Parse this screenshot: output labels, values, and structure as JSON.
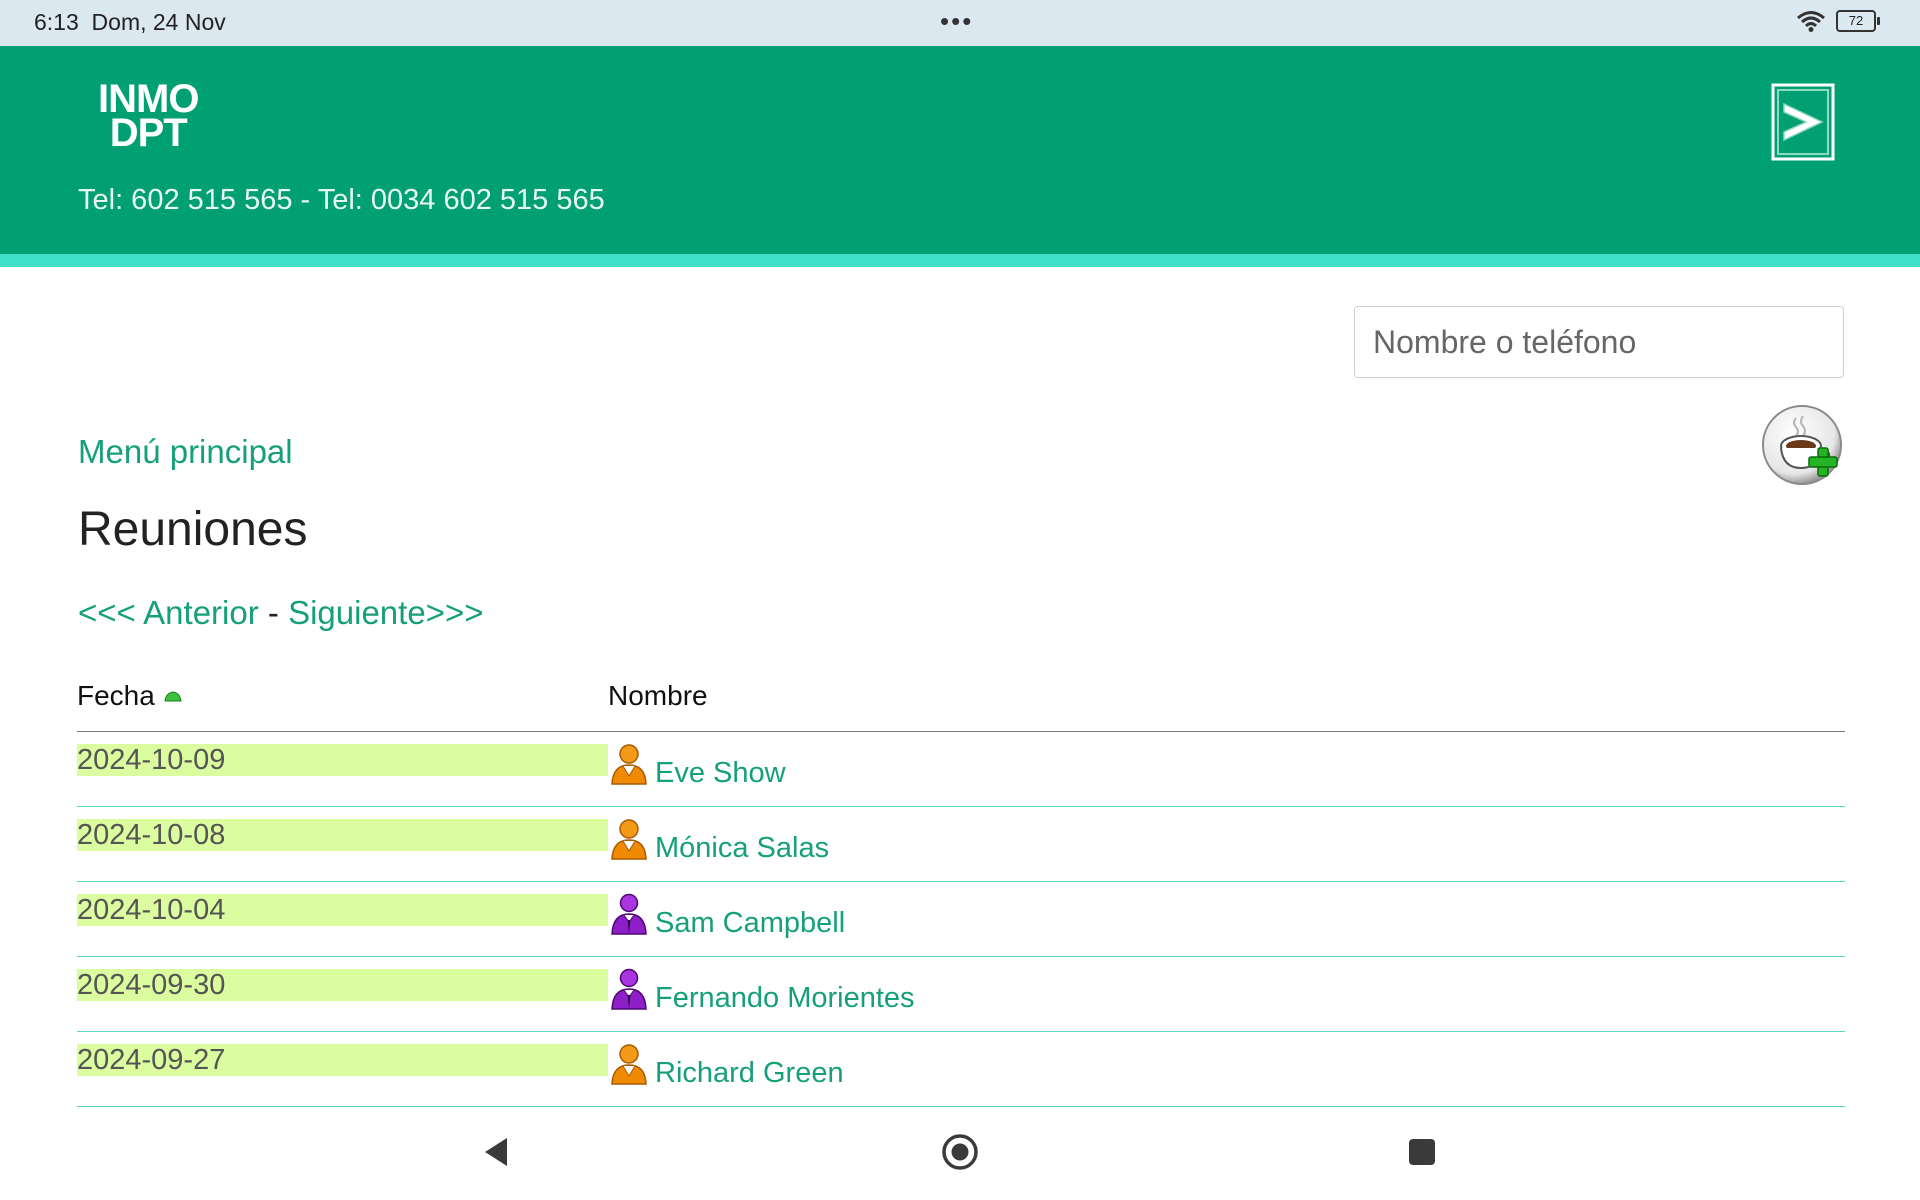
{
  "status_bar": {
    "time": "6:13",
    "date": "Dom, 24 Nov",
    "dots": "•••",
    "battery": "72"
  },
  "header": {
    "logo_line1": "INMO",
    "logo_line2": "DPT",
    "phone": "Tel: 602 515 565 - Tel: 0034 602 515 565",
    "logout_icon": "logout-arrow-icon"
  },
  "search": {
    "placeholder": "Nombre o teléfono",
    "value": ""
  },
  "nav": {
    "main_menu": "Menú principal"
  },
  "page": {
    "title": "Reuniones",
    "add_icon": "coffee-add-icon"
  },
  "pagination": {
    "prev": "<<< Anterior",
    "separator": "-",
    "next": "Siguiente>>>"
  },
  "table": {
    "columns": [
      "Fecha",
      "Nombre"
    ],
    "sort_icon": "sort-ascending-icon",
    "rows": [
      {
        "date": "2024-10-09",
        "name": "Eve Show",
        "icon": "person-orange-icon"
      },
      {
        "date": "2024-10-08",
        "name": "Mónica Salas",
        "icon": "person-orange-icon"
      },
      {
        "date": "2024-10-04",
        "name": "Sam Campbell",
        "icon": "person-purple-icon"
      },
      {
        "date": "2024-09-30",
        "name": "Fernando Morientes",
        "icon": "person-purple-icon"
      },
      {
        "date": "2024-09-27",
        "name": "Richard Green",
        "icon": "person-orange-icon"
      }
    ]
  },
  "colors": {
    "header_bg": "#00a073",
    "header_strip": "#40e0c8",
    "link": "#16a07a",
    "date_highlight": "#dcfca0",
    "row_border": "#5fd6c2",
    "person_orange": "#f08a00",
    "person_purple": "#8e1fc8"
  }
}
